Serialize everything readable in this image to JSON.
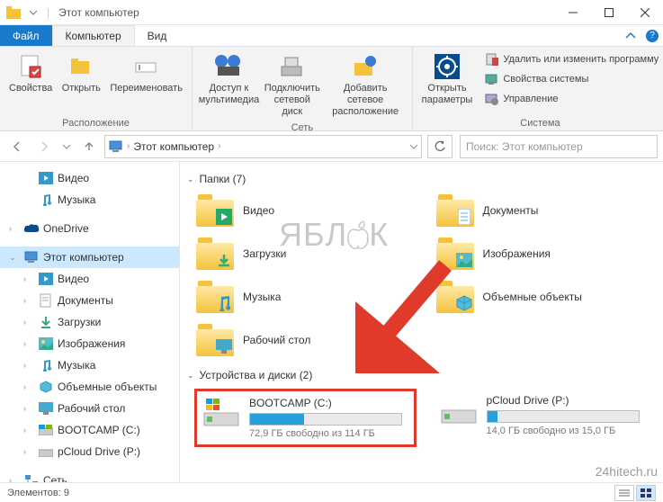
{
  "window": {
    "title": "Этот компьютер"
  },
  "tabs": {
    "file": "Файл",
    "computer": "Компьютер",
    "view": "Вид"
  },
  "ribbon": {
    "location": {
      "properties": "Свойства",
      "open": "Открыть",
      "rename": "Переименовать",
      "group": "Расположение"
    },
    "network": {
      "media": "Доступ к\nмультимедиа",
      "map": "Подключить\nсетевой диск",
      "add": "Добавить сетевое\nрасположение",
      "group": "Сеть"
    },
    "system": {
      "settings": "Открыть\nпараметры",
      "uninstall": "Удалить или изменить программу",
      "sysprops": "Свойства системы",
      "manage": "Управление",
      "group": "Система"
    }
  },
  "nav": {
    "crumb": "Этот компьютер",
    "search_placeholder": "Поиск: Этот компьютер"
  },
  "sidebar": {
    "video": "Видео",
    "music": "Музыка",
    "onedrive": "OneDrive",
    "thispc": "Этот компьютер",
    "pc_video": "Видео",
    "pc_documents": "Документы",
    "pc_downloads": "Загрузки",
    "pc_pictures": "Изображения",
    "pc_music": "Музыка",
    "pc_3d": "Объемные объекты",
    "pc_desktop": "Рабочий стол",
    "pc_bootcamp": "BOOTCAMP (C:)",
    "pc_pcloud": "pCloud Drive (P:)",
    "network": "Сеть"
  },
  "content": {
    "folders_header": "Папки (7)",
    "folders": [
      {
        "label": "Видео",
        "overlay": "video"
      },
      {
        "label": "Документы",
        "overlay": "doc"
      },
      {
        "label": "Загрузки",
        "overlay": "download"
      },
      {
        "label": "Изображения",
        "overlay": "picture"
      },
      {
        "label": "Музыка",
        "overlay": "music"
      },
      {
        "label": "Объемные объекты",
        "overlay": "3d"
      },
      {
        "label": "Рабочий стол",
        "overlay": "desktop"
      }
    ],
    "drives_header": "Устройства и диски (2)",
    "drives": [
      {
        "name": "BOOTCAMP (C:)",
        "status": "72,9 ГБ свободно из 114 ГБ",
        "fill_pct": 36,
        "highlighted": true,
        "win": true
      },
      {
        "name": "pCloud Drive (P:)",
        "status": "14,0 ГБ свободно из 15,0 ГБ",
        "fill_pct": 7,
        "highlighted": false,
        "win": false
      }
    ]
  },
  "statusbar": {
    "count": "Элементов: 9"
  },
  "watermark_text": {
    "p1": "ЯБЛ",
    "p2": "К"
  },
  "source": "24hitech.ru"
}
